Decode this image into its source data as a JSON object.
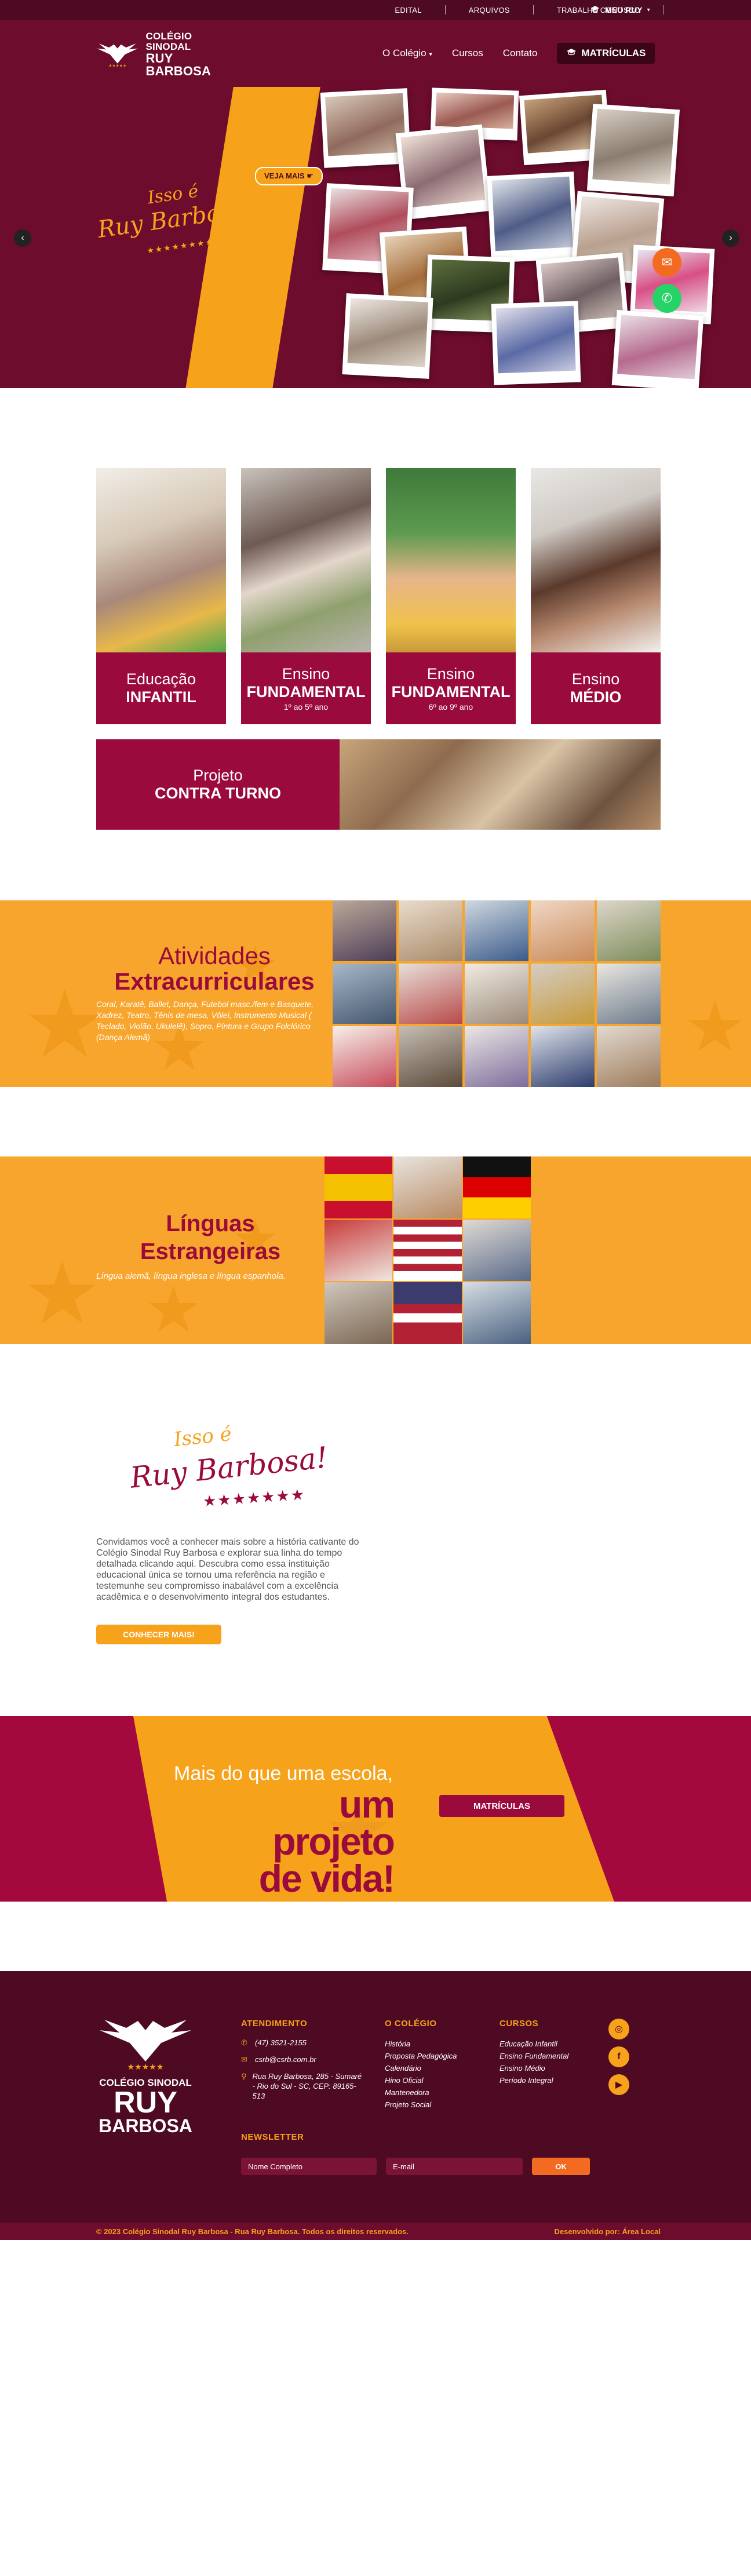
{
  "topbar": {
    "links": [
      "EDITAL",
      "ARQUIVOS",
      "TRABALHE CONOSCO"
    ],
    "meu_ruy": "MEU RUY"
  },
  "header": {
    "logo_line1": "COLÉGIO SINODAL",
    "logo_line2": "RUY BARBOSA",
    "nav": [
      "O Colégio",
      "Cursos",
      "Contato"
    ],
    "matriculas": "MATRÍCULAS"
  },
  "hero": {
    "tagline_line1": "Isso é",
    "tagline_line2": "Ruy Barbosa!",
    "veja_mais": "VEJA MAIS"
  },
  "levels": [
    {
      "l1": "Educação",
      "l2": "INFANTIL",
      "l3": ""
    },
    {
      "l1": "Ensino",
      "l2": "FUNDAMENTAL",
      "l3": "1º ao 5º ano"
    },
    {
      "l1": "Ensino",
      "l2": "FUNDAMENTAL",
      "l3": "6º ao 9º ano"
    },
    {
      "l1": "Ensino",
      "l2": "MÉDIO",
      "l3": ""
    }
  ],
  "contraturno": {
    "l1": "Projeto",
    "l2": "CONTRA TURNO"
  },
  "atividades": {
    "t1": "Atividades",
    "t2": "Extracurriculares",
    "desc": "Coral, Karatê, Ballet, Dança, Futebol masc./fem e Basquete, Xadrez, Teatro, Tênis de mesa, Vôlei, Instrumento Musical ( Teclado, Violão, Ukulelê), Sopro, Pintura e Grupo Folclórico (Dança Alemã)"
  },
  "linguas": {
    "t1": "Línguas",
    "t2": "Estrangeiras",
    "desc": "Língua alemã, língua inglesa e língua espanhola."
  },
  "isso": {
    "line1": "Isso é",
    "line2": "Ruy Barbosa!",
    "text": "Convidamos você a conhecer mais sobre a história cativante do Colégio Sinodal Ruy Barbosa e explorar sua linha do tempo detalhada clicando aqui. Descubra como essa instituição educacional única se tornou uma referência na região e testemunhe seu compromisso inabalável com a excelência acadêmica e o desenvolvimento integral dos estudantes.",
    "button": "CONHECER MAIS!"
  },
  "vida": {
    "line1": "Mais do que uma escola,",
    "line2": "um projeto",
    "line3": "de vida!",
    "button": "MATRÍCULAS"
  },
  "footer": {
    "logo_line1": "COLÉGIO SINODAL",
    "logo_line2": "RUY",
    "logo_line3": "BARBOSA",
    "atendimento_title": "ATENDIMENTO",
    "phone": "(47) 3521-2155",
    "email": "csrb@csrb.com.br",
    "address": "Rua Ruy Barbosa, 285 - Sumaré - Rio do Sul - SC, CEP: 89165-513",
    "colegio_title": "O COLÉGIO",
    "colegio_items": [
      "História",
      "Proposta Pedagógica",
      "Calendário",
      "Hino Oficial",
      "Mantenedora",
      "Projeto Social"
    ],
    "cursos_title": "CURSOS",
    "cursos_items": [
      "Educação Infantil",
      "Ensino Fundamental",
      "Ensino Médio",
      "Período Integral"
    ],
    "newsletter_title": "NEWSLETTER",
    "name_placeholder": "Nome Completo",
    "email_placeholder": "E-mail",
    "ok": "OK",
    "copyright": "© 2023 Colégio Sinodal Ruy Barbosa - Rua Ruy Barbosa. Todos os direitos reservados.",
    "dev": "Desenvolvido por: Área Local"
  },
  "colors": {
    "wine": "#6d0c2c",
    "dark_wine": "#4e0a22",
    "crimson": "#9b0a3c",
    "orange": "#f7a21b"
  }
}
